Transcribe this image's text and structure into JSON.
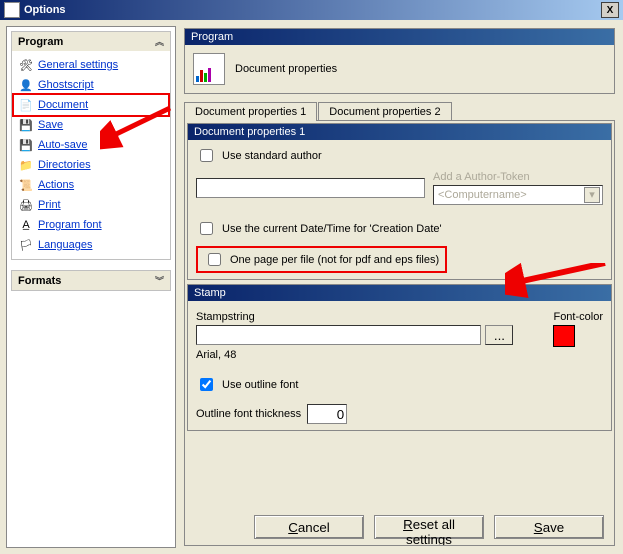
{
  "title": "Options",
  "close_label": "X",
  "sidebar": {
    "program": {
      "title": "Program",
      "items": [
        {
          "label": "General settings"
        },
        {
          "label": "Ghostscript"
        },
        {
          "label": "Document"
        },
        {
          "label": "Save"
        },
        {
          "label": "Auto-save"
        },
        {
          "label": "Directories"
        },
        {
          "label": "Actions"
        },
        {
          "label": "Print"
        },
        {
          "label": "Program font"
        },
        {
          "label": "Languages"
        }
      ]
    },
    "formats": {
      "title": "Formats"
    }
  },
  "main": {
    "header_group": "Program",
    "header_desc": "Document properties",
    "tabs": [
      {
        "label": "Document properties 1"
      },
      {
        "label": "Document properties 2"
      }
    ],
    "docprops": {
      "title": "Document properties 1",
      "use_std_author": "Use standard author",
      "author_value": "",
      "token_label": "Add a Author-Token",
      "token_placeholder": "<Computername>",
      "use_current_date": "Use the current Date/Time for 'Creation Date'",
      "one_page_per_file": "One page per file (not for pdf and eps files)"
    },
    "stamp": {
      "title": "Stamp",
      "stampstring_label": "Stampstring",
      "stampstring_value": "",
      "browse": "...",
      "font_desc": "Arial, 48",
      "fontcolor_label": "Font-color",
      "fontcolor_value": "#ff0000",
      "use_outline": "Use outline font",
      "outline_thickness_label": "Outline font thickness",
      "outline_thickness_value": "0"
    },
    "buttons": {
      "cancel": "Cancel",
      "reset": "Reset all settings",
      "save": "Save"
    }
  }
}
